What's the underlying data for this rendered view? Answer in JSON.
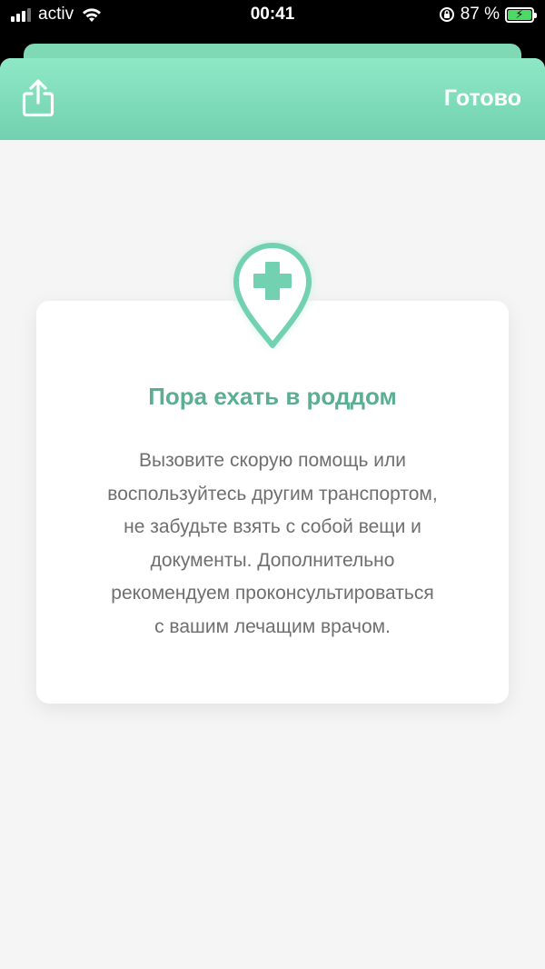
{
  "status_bar": {
    "carrier": "activ",
    "time": "00:41",
    "battery_percent": "87 %"
  },
  "nav": {
    "share_icon": "share-icon",
    "done_label": "Готово"
  },
  "card": {
    "icon": "medical-location-pin-icon",
    "title": "Пора ехать в роддом",
    "body_lines": [
      "Вызовите скорую помощь или",
      "воспользуйтесь другим транспортом,",
      "не забудьте взять с собой вещи и",
      "документы. Дополнительно",
      "рекомендуем проконсультироваться",
      "с вашим лечащим врачом."
    ]
  },
  "colors": {
    "accent": "#72d1b0",
    "title": "#5cae93",
    "body_text": "#6f6f6f",
    "background": "#f5f5f5"
  }
}
